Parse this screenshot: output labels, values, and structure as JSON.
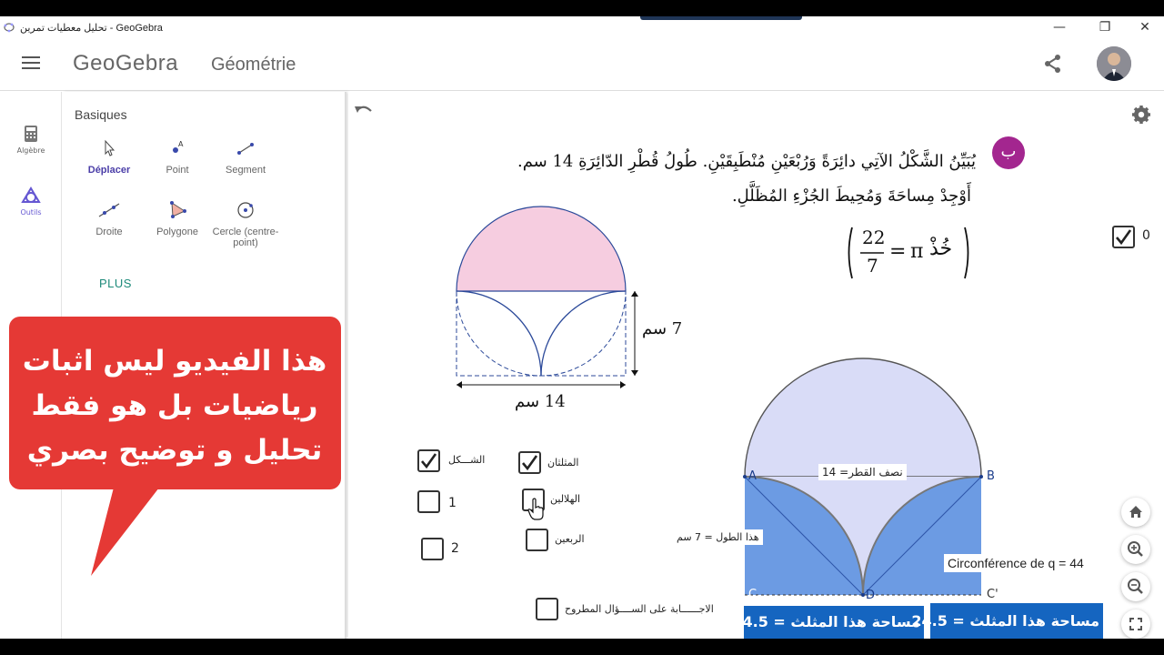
{
  "window": {
    "title": "تحليل معطيات تمرين - GeoGebra",
    "minimize": "—",
    "maximize": "❐",
    "close": "✕"
  },
  "header": {
    "logo": "GeoGebra",
    "app_name": "Géométrie"
  },
  "rail": {
    "items": [
      {
        "label": "Algèbre",
        "icon": "calculator-icon"
      },
      {
        "label": "Outils",
        "icon": "tools-icon"
      }
    ]
  },
  "tools": {
    "category": "Basiques",
    "items": [
      {
        "label": "Déplacer",
        "icon": "move-arrow-icon",
        "active": true
      },
      {
        "label": "Point",
        "icon": "point-icon"
      },
      {
        "label": "Segment",
        "icon": "segment-icon"
      },
      {
        "label": "Droite",
        "icon": "line-icon"
      },
      {
        "label": "Polygone",
        "icon": "polygon-icon"
      },
      {
        "label": "Cercle (centre-point)",
        "icon": "circle-center-point-icon"
      }
    ],
    "more": "PLUS"
  },
  "callout": {
    "lines": [
      "هذا الفيديو ليس اثبات",
      "رياضيات بل هو فقط",
      "تحليل و توضيح بصري"
    ],
    "color": "#e53935"
  },
  "problem": {
    "badge": "ب",
    "line1": "يُبَيِّنُ الشَّكْلُ الآتِي دائِرَةً وَرُبْعَيْنِ مُنْطَبِقَيْنِ. طُولُ قُطْرِ الدّائِرَةِ 14 سم.",
    "line2": "أَوْجِدْ مِساحَةَ وَمُحِيطَ الجُزْءِ المُظَلَّلِ.",
    "hint_word": "خُذْ",
    "hint_pi": "π",
    "hint_eq": "=",
    "hint_num": "22",
    "hint_den": "7",
    "dim_height": "7 سم",
    "dim_width": "14 سم"
  },
  "checkboxes": {
    "top_right": {
      "label": "0",
      "checked": true
    },
    "shape": {
      "label": "الشـــكل",
      "checked": true
    },
    "triangles": {
      "label": "المثلثان",
      "checked": true
    },
    "c1": {
      "label": "1",
      "checked": false
    },
    "crescents": {
      "label": "الهلالين",
      "checked": false
    },
    "c2": {
      "label": "2",
      "checked": false
    },
    "quarters": {
      "label": "الربعين",
      "checked": false
    },
    "answer": {
      "label": "الاجــــــابة على الســــؤال المطروح",
      "checked": false
    }
  },
  "figure": {
    "label_A": "A",
    "label_B": "B",
    "label_C1": "C",
    "label_C1_sub": "1",
    "label_D": "D",
    "label_Cp": "C'",
    "radius_label": "نصف القطر= 14",
    "length_label": "هذا الطول = 7 سم",
    "circumference": "Circonférence de q = 44",
    "area_left": "مساحة هذا  المثلث  =  24.5",
    "area_right": "مساحة هذا  المثلث  = 24.5"
  },
  "colors": {
    "accent": "#7b1fa2",
    "blue_fill": "#4a7fd6",
    "lilac_fill": "#d9dcf7",
    "pink_fill": "#f6cde0",
    "label_blue": "#1565c0"
  }
}
